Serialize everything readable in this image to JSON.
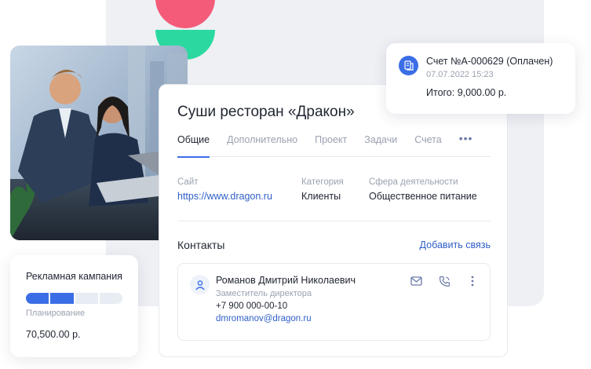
{
  "campaign": {
    "title": "Рекламная кампания",
    "stage": "Планирование",
    "amount": "70,500.00 р.",
    "progress": {
      "done_segments": 2,
      "total_segments": 4
    }
  },
  "company": {
    "name": "Суши ресторан «Дракон»",
    "tabs": [
      {
        "label": "Общие",
        "active": true
      },
      {
        "label": "Дополнительно",
        "active": false
      },
      {
        "label": "Проект",
        "active": false
      },
      {
        "label": "Задачи",
        "active": false
      },
      {
        "label": "Счета",
        "active": false
      }
    ],
    "more_label": "•••",
    "fields": {
      "site": {
        "label": "Сайт",
        "value": "https://www.dragon.ru"
      },
      "category": {
        "label": "Категория",
        "value": "Клиенты"
      },
      "sphere": {
        "label": "Сфера деятельности",
        "value": "Общественное питание"
      }
    }
  },
  "contacts": {
    "title": "Контакты",
    "add_label": "Добавить связь",
    "items": [
      {
        "name": "Романов Дмитрий Николаевич",
        "role": "Заместитель директора",
        "phone": "+7 900 000-00-10",
        "email": "dmromanov@dragon.ru",
        "icons": [
          "mail-icon",
          "phone-icon",
          "more-vertical-icon"
        ]
      }
    ]
  },
  "invoice": {
    "title": "Счет №А-000629 (Оплачен)",
    "date": "07.07.2022 15:23",
    "total": "Итого: 9,000.00 р.",
    "icon": "document-icon"
  },
  "colors": {
    "accent": "#3b6ee6",
    "link": "#2f5fc7",
    "deco_pink": "#f45b79",
    "deco_green": "#2bd9a0",
    "background_panel": "#eef0f4"
  }
}
